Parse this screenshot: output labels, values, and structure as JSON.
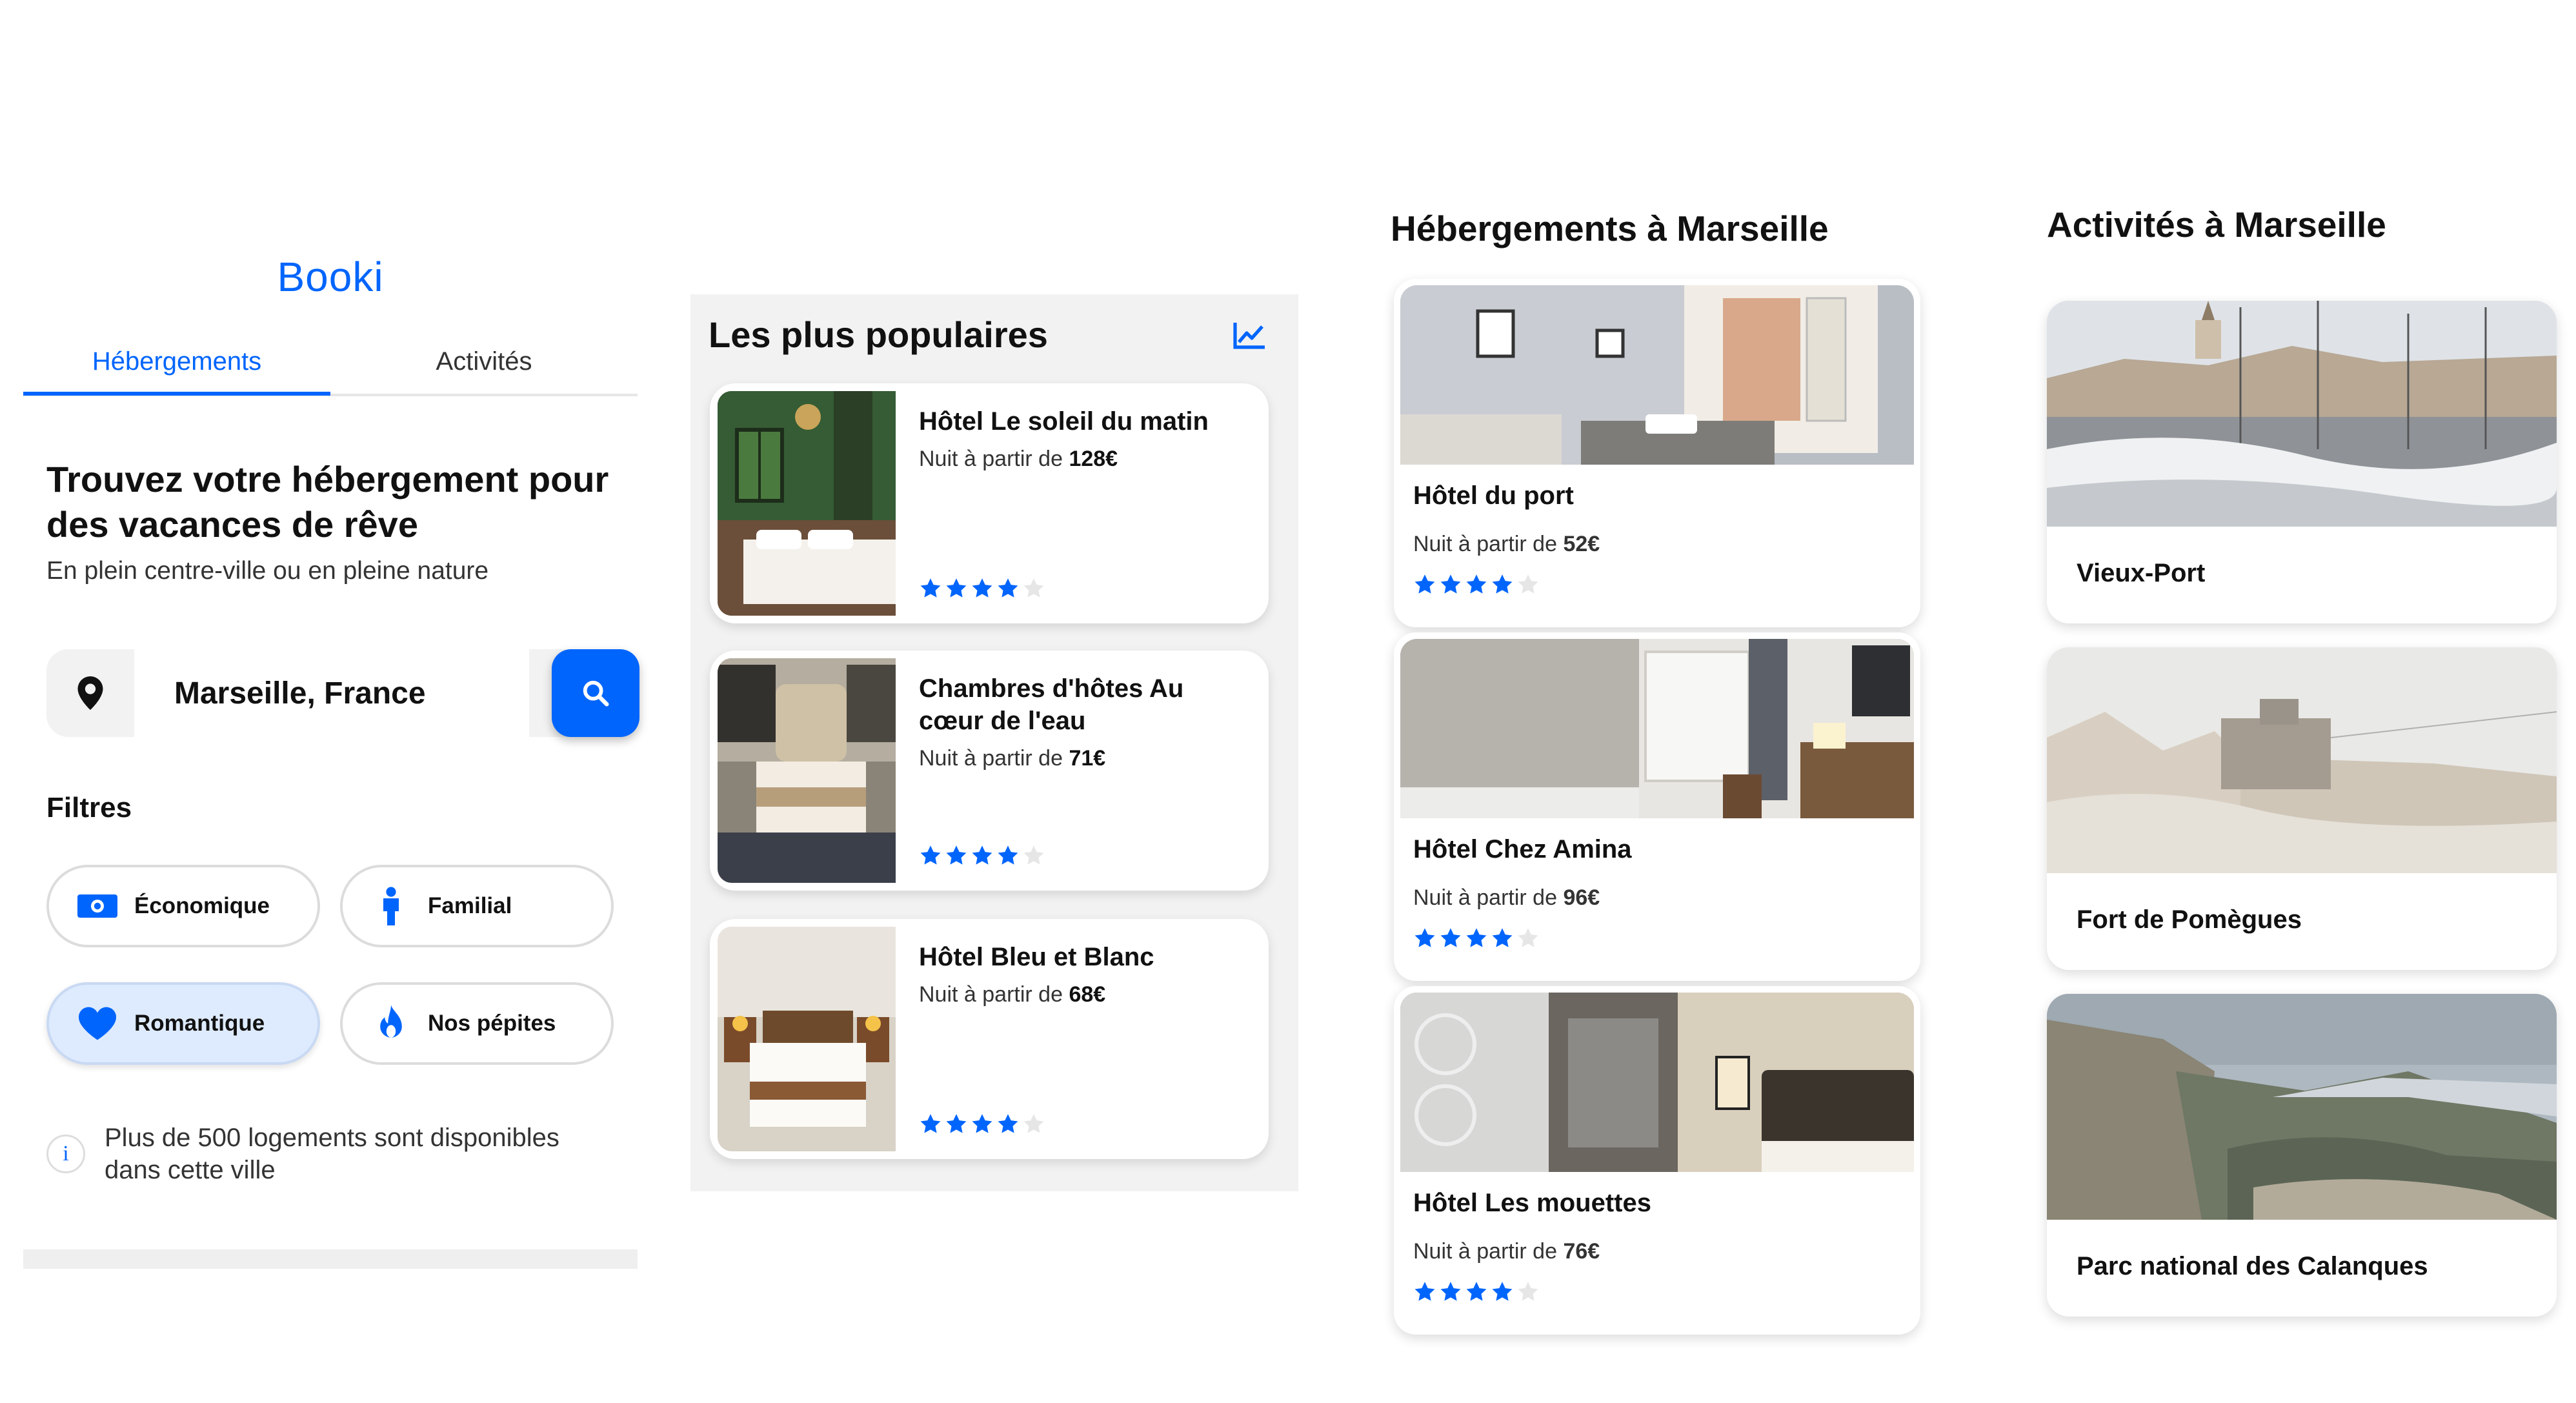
{
  "colors": {
    "accent": "#0065FC",
    "chip_active": "#DEEBFF",
    "star_empty": "#e6e6e6"
  },
  "search_panel": {
    "logo": "Booki",
    "tabs": [
      "Hébergements",
      "Activités"
    ],
    "heading": "Trouvez votre hébergement pour des vacances de rêve",
    "subtitle": "En plein centre-ville ou en pleine nature",
    "search_value": "Marseille, France",
    "filters_title": "Filtres",
    "filters": [
      {
        "label": "Économique",
        "icon": "money-icon",
        "active": false
      },
      {
        "label": "Familial",
        "icon": "person-icon",
        "active": false
      },
      {
        "label": "Romantique",
        "icon": "heart-icon",
        "active": true
      },
      {
        "label": "Nos pépites",
        "icon": "fire-icon",
        "active": false
      }
    ],
    "info": "Plus de 500 logements sont disponibles dans cette ville"
  },
  "popular": {
    "title": "Les plus populaires",
    "items": [
      {
        "name": "Hôtel Le soleil du matin",
        "price_prefix": "Nuit à partir de ",
        "price": "128€",
        "rating": 4
      },
      {
        "name": "Chambres d'hôtes Au cœur de l'eau",
        "price_prefix": "Nuit à partir de ",
        "price": "71€",
        "rating": 4
      },
      {
        "name": "Hôtel Bleu et Blanc",
        "price_prefix": "Nuit à partir de ",
        "price": "68€",
        "rating": 4
      }
    ]
  },
  "accommodations": {
    "title": "Hébergements à Marseille",
    "items": [
      {
        "name": "Hôtel du port",
        "price_prefix": "Nuit à partir de ",
        "price": "52€",
        "rating": 4
      },
      {
        "name": "Hôtel Chez Amina",
        "price_prefix": "Nuit à partir de ",
        "price": "96€",
        "rating": 4
      },
      {
        "name": "Hôtel Les mouettes",
        "price_prefix": "Nuit à partir de ",
        "price": "76€",
        "rating": 4
      }
    ]
  },
  "activities": {
    "title": "Activités à Marseille",
    "items": [
      {
        "name": "Vieux-Port"
      },
      {
        "name": "Fort de Pomègues"
      },
      {
        "name": "Parc national des Calanques"
      }
    ]
  }
}
